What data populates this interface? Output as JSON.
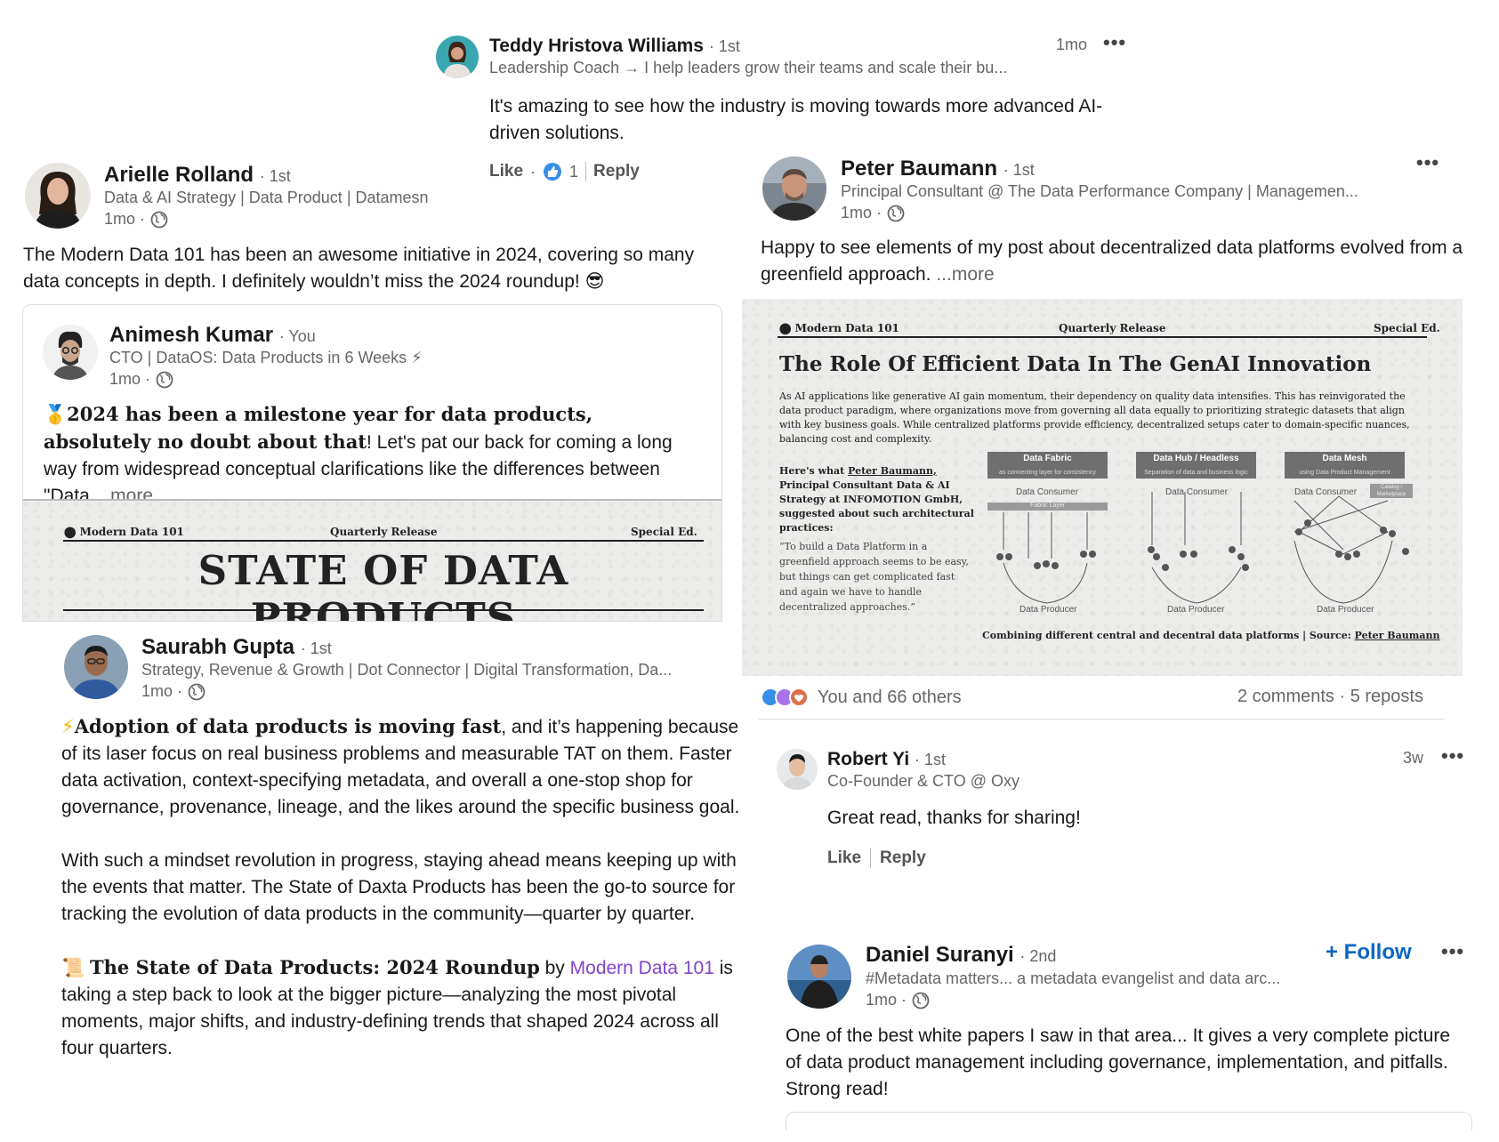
{
  "teddy": {
    "name": "Teddy Hristova Williams",
    "degree": "· 1st",
    "headline": "Leadership Coach → I help leaders grow their teams and scale their bu...",
    "time": "1mo",
    "text": "It's amazing to see how the industry is moving towards more advanced AI-driven solutions.",
    "like_label": "Like",
    "like_count": "1",
    "reply_label": "Reply"
  },
  "arielle": {
    "name": "Arielle Rolland",
    "degree": "· 1st",
    "headline": "Data & AI Strategy | Data Product | Datamesn",
    "time": "1mo ·",
    "text": "The Modern Data 101 has been an awesome initiative in 2024, covering so many data concepts in depth. I definitely wouldn’t miss the 2024 roundup! 😎"
  },
  "animesh": {
    "name": "Animesh Kumar",
    "degree": "· You",
    "headline": "CTO | DataOS: Data Products in 6 Weeks ⚡",
    "time": "1mo ·",
    "text_bold": "2024 has been a milestone year for data products, absolutely no doubt about that",
    "text_rest": "! Let's pat our back for coming a long way from widespread conceptual clarifications like the differences between \"Data",
    "more": "...more",
    "medal": "🥇"
  },
  "sodp_banner": {
    "brand": "Modern Data 101",
    "release": "Quarterly Release",
    "edition": "Special Ed.",
    "title": "STATE OF DATA PRODUCTS"
  },
  "saurabh": {
    "name": "Saurabh Gupta",
    "degree": "· 1st",
    "headline": "Strategy, Revenue & Growth | Dot Connector | Digital Transformation, Da...",
    "time": "1mo ·",
    "p1_bold": "Adoption of data products is moving fast",
    "p1_rest": ", and it’s happening because of its laser focus on real business problems and measurable TAT on them. Faster data activation, context-specifying metadata, and overall a one-stop shop for governance, provenance, lineage, and the likes around the specific business goal.",
    "p2": "With such a mindset revolution in progress, staying ahead means keeping up with the events that matter. The State of Daxta Products has been the go-to source for tracking the evolution of data products in the community—quarter by quarter.",
    "p3_bold": "The State of Data Products",
    "p3_bold2": ": 2024 Roundup",
    "p3_by": " by ",
    "p3_link": "Modern Data 101",
    "p3_rest": " is taking a step back to look at the bigger picture—analyzing the most pivotal moments, major shifts, and industry-defining trends that shaped 2024 across all four quarters."
  },
  "peter": {
    "name": "Peter Baumann",
    "degree": "· 1st",
    "headline": "Principal Consultant @ The Data Performance Company | Managemen...",
    "time": "1mo ·",
    "text": "Happy to see elements of my post about decentralized data platforms evolved from a greenfield approach.",
    "more": "...more"
  },
  "genai_card": {
    "brand": "Modern Data 101",
    "release": "Quarterly Release",
    "edition": "Special Ed.",
    "title": "The Role Of Efficient Data In The GenAI Innovation",
    "para": "As AI applications like generative AI gain momentum, their dependency on quality data intensifies. This has reinvigorated the data product paradigm, where organizations move from governing all data equally to prioritizing strategic datasets that align with key business goals. While centralized platforms provide efficiency, decentralized setups cater to domain-specific nuances, balancing cost and complexity.",
    "left_intro": "Here's what",
    "left_name": "Peter Baumann,",
    "left_rest": "Principal Consultant Data & AI Strategy at INFOMOTION GmbH, suggested about such architectural practices:",
    "quote": "“To build a Data Platform in a greenfield approach seems to be easy, but things can get complicated fast and again we have to handle decentralized approaches.”",
    "boxes": [
      {
        "title": "Data Fabric",
        "subtitle": "as connecting layer for consistency",
        "consumer": "Data Consumer",
        "producer": "Data Producer",
        "layer": "Fabric Layer"
      },
      {
        "title": "Data Hub / Headless",
        "subtitle": "Separation of data and business logic",
        "consumer": "Data Consumer",
        "producer": "Data Producer",
        "layer": ""
      },
      {
        "title": "Data Mesh",
        "subtitle": "using Data Product Management",
        "consumer": "Data Consumer",
        "producer": "Data Producer",
        "layer": "Catalog / Marketplace"
      }
    ],
    "caption": "Combining different central and decentral data platforms | Source:",
    "caption_link": "Peter Baumann"
  },
  "reactions": {
    "text": "You and 66 others",
    "counts": "2 comments · 5 reposts"
  },
  "robert": {
    "name": "Robert Yi",
    "degree": "· 1st",
    "headline": "Co-Founder & CTO @ Oxy",
    "time": "3w",
    "text": "Great read, thanks for sharing!",
    "like_label": "Like",
    "reply_label": "Reply"
  },
  "daniel": {
    "name": "Daniel Suranyi",
    "degree": "· 2nd",
    "headline": "#Metadata matters... a metadata evangelist and data arc...",
    "time": "1mo ·",
    "follow": "+ Follow",
    "text": "One of the best white papers I saw in that area... It gives a very complete picture of data product management including governance, implementation, and pitfalls. Strong read!"
  },
  "colors": {
    "link": "#0a66c2",
    "purple_link": "#8344cc",
    "muted": "#666666"
  }
}
